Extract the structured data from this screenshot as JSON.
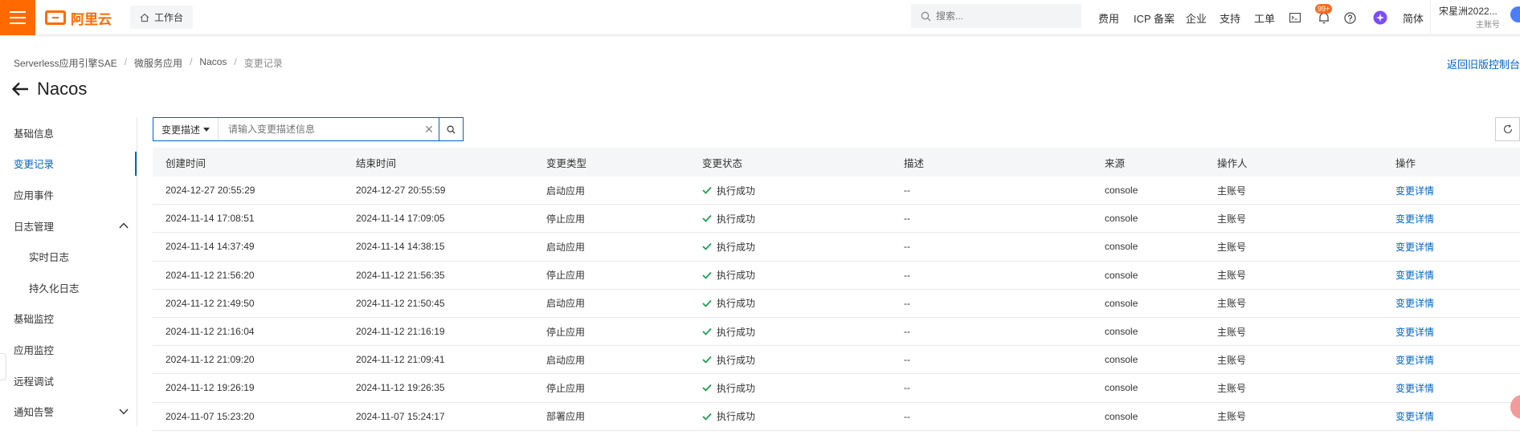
{
  "topbar": {
    "brand": "阿里云",
    "workbench": "工作台",
    "search_placeholder": "搜索...",
    "nav": [
      "费用",
      "ICP 备案",
      "企业",
      "支持",
      "工单"
    ],
    "badge": "99+",
    "lang": "简体",
    "user_name": "宋星洲2022...",
    "user_role": "主账号"
  },
  "breadcrumb": [
    "Serverless应用引擎SAE",
    "微服务应用",
    "Nacos",
    "变更记录"
  ],
  "back_old": "返回旧版控制台",
  "page_title": "Nacos",
  "sidebar": [
    {
      "label": "基础信息"
    },
    {
      "label": "变更记录"
    },
    {
      "label": "应用事件"
    },
    {
      "label": "日志管理"
    },
    {
      "label": "实时日志"
    },
    {
      "label": "持久化日志"
    },
    {
      "label": "基础监控"
    },
    {
      "label": "应用监控"
    },
    {
      "label": "远程调试"
    },
    {
      "label": "通知告警"
    }
  ],
  "filter": {
    "select": "变更描述",
    "placeholder": "请输入变更描述信息"
  },
  "table": {
    "headers": [
      "创建时间",
      "结束时间",
      "变更类型",
      "变更状态",
      "描述",
      "来源",
      "操作人",
      "操作"
    ],
    "rows": [
      {
        "created": "2024-12-27 20:55:29",
        "ended": "2024-12-27 20:55:59",
        "type": "启动应用",
        "status": "执行成功",
        "desc": "--",
        "source": "console",
        "operator": "主账号",
        "action": "变更详情"
      },
      {
        "created": "2024-11-14 17:08:51",
        "ended": "2024-11-14 17:09:05",
        "type": "停止应用",
        "status": "执行成功",
        "desc": "--",
        "source": "console",
        "operator": "主账号",
        "action": "变更详情"
      },
      {
        "created": "2024-11-14 14:37:49",
        "ended": "2024-11-14 14:38:15",
        "type": "启动应用",
        "status": "执行成功",
        "desc": "--",
        "source": "console",
        "operator": "主账号",
        "action": "变更详情"
      },
      {
        "created": "2024-11-12 21:56:20",
        "ended": "2024-11-12 21:56:35",
        "type": "停止应用",
        "status": "执行成功",
        "desc": "--",
        "source": "console",
        "operator": "主账号",
        "action": "变更详情"
      },
      {
        "created": "2024-11-12 21:49:50",
        "ended": "2024-11-12 21:50:45",
        "type": "启动应用",
        "status": "执行成功",
        "desc": "--",
        "source": "console",
        "operator": "主账号",
        "action": "变更详情"
      },
      {
        "created": "2024-11-12 21:16:04",
        "ended": "2024-11-12 21:16:19",
        "type": "停止应用",
        "status": "执行成功",
        "desc": "--",
        "source": "console",
        "operator": "主账号",
        "action": "变更详情"
      },
      {
        "created": "2024-11-12 21:09:20",
        "ended": "2024-11-12 21:09:41",
        "type": "启动应用",
        "status": "执行成功",
        "desc": "--",
        "source": "console",
        "operator": "主账号",
        "action": "变更详情"
      },
      {
        "created": "2024-11-12 19:26:19",
        "ended": "2024-11-12 19:26:35",
        "type": "停止应用",
        "status": "执行成功",
        "desc": "--",
        "source": "console",
        "operator": "主账号",
        "action": "变更详情"
      },
      {
        "created": "2024-11-07 15:23:20",
        "ended": "2024-11-07 15:24:17",
        "type": "部署应用",
        "status": "执行成功",
        "desc": "--",
        "source": "console",
        "operator": "主账号",
        "action": "变更详情"
      }
    ]
  },
  "colors": {
    "brand": "#ff6a00",
    "link": "#0064c8",
    "success": "#1e9e50"
  }
}
